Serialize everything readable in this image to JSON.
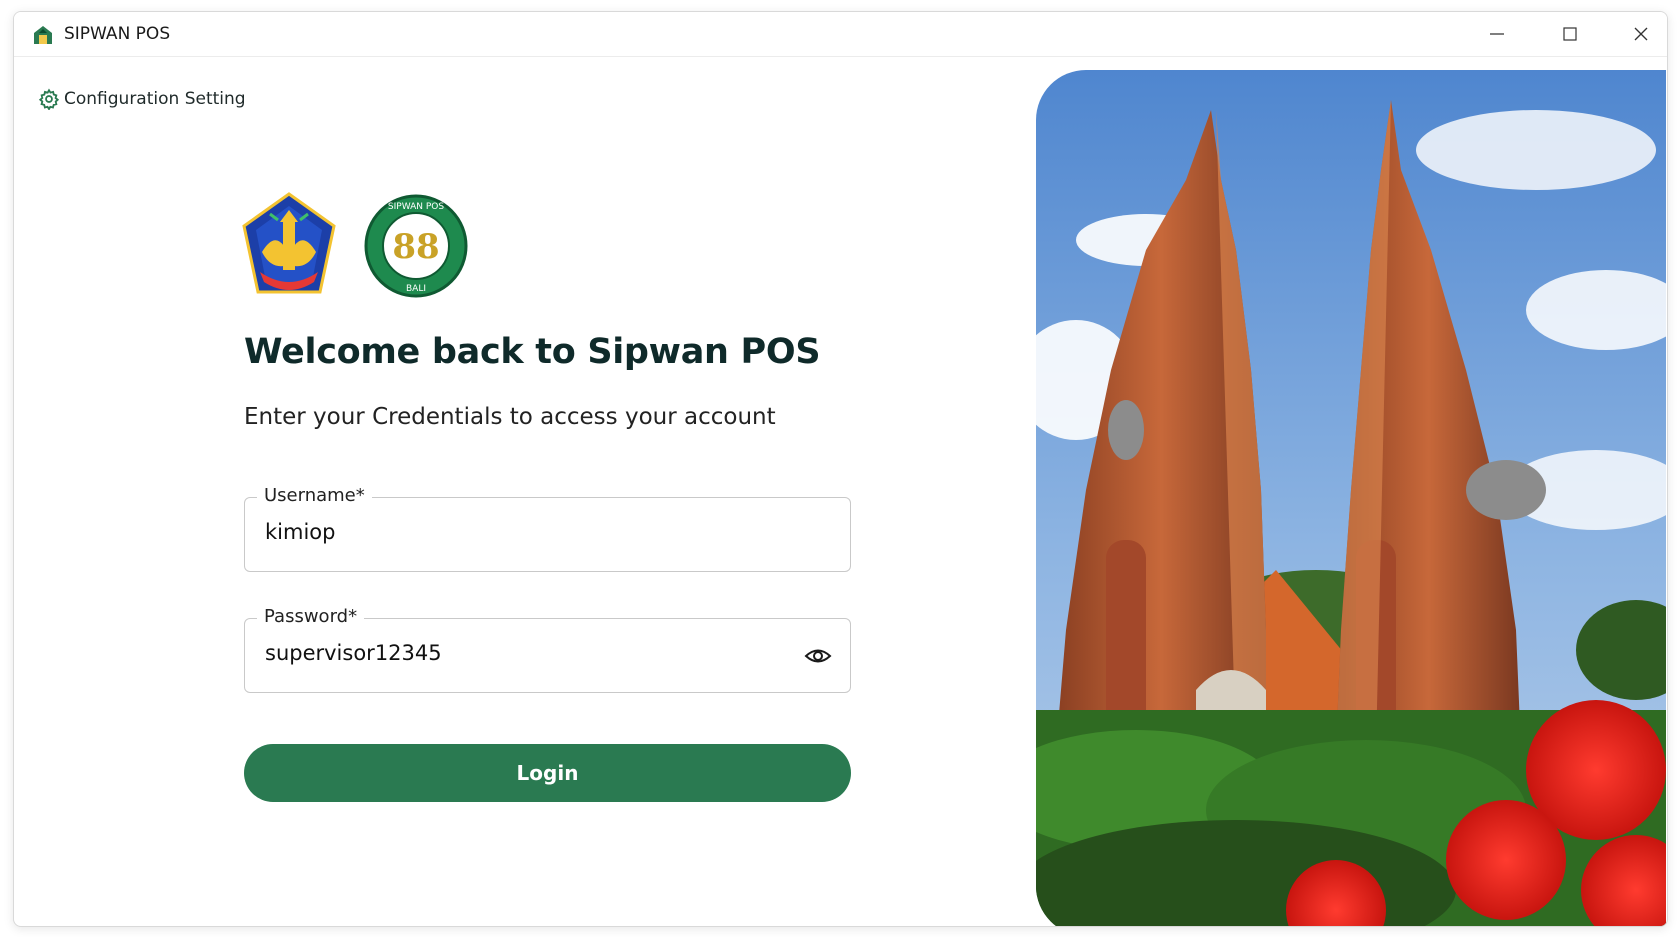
{
  "window": {
    "title": "SIPWAN POS",
    "controls": [
      "minimize",
      "maximize",
      "close"
    ]
  },
  "config": {
    "label": "Configuration Setting",
    "icon": "gear-icon"
  },
  "logos": {
    "left": "bali-province-emblem",
    "right": {
      "top_text": "SIPWAN POS",
      "center_text": "88",
      "bottom_text": "BALI"
    }
  },
  "heading": "Welcome back to Sipwan POS",
  "subheading": "Enter your Credentials to access your account",
  "form": {
    "username": {
      "label": "Username*",
      "value": "kimiop"
    },
    "password": {
      "label": "Password*",
      "value": "supervisor12345",
      "toggle_icon": "eye-icon"
    },
    "login_label": "Login"
  },
  "colors": {
    "primary": "#2a7a51",
    "heading": "#0f2a2a",
    "border": "#c9c9c9"
  },
  "hero": {
    "image": "balinese-split-gate-temple-photo"
  }
}
